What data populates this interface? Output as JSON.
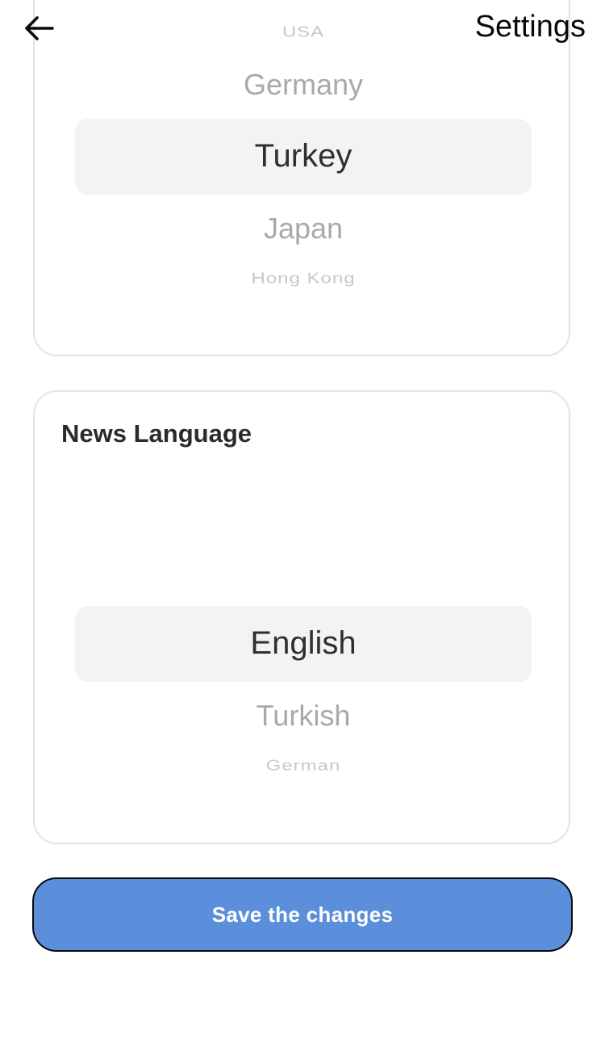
{
  "header": {
    "back_icon": "arrow-left-icon",
    "title": "Settings"
  },
  "country_picker": {
    "options_visible": [
      "USA",
      "Germany",
      "Turkey",
      "Japan",
      "Hong Kong"
    ],
    "above_far": "USA",
    "above_near": "Germany",
    "selected": "Turkey",
    "below_near": "Japan",
    "below_far": "Hong Kong"
  },
  "language_section": {
    "title": "News Language",
    "selected": "English",
    "below_near": "Turkish",
    "below_far": "German"
  },
  "save_button": {
    "label": "Save the changes"
  },
  "colors": {
    "accent": "#5b8fdc",
    "highlight": "#f3f3f3",
    "card_border": "#e4e4e4"
  }
}
